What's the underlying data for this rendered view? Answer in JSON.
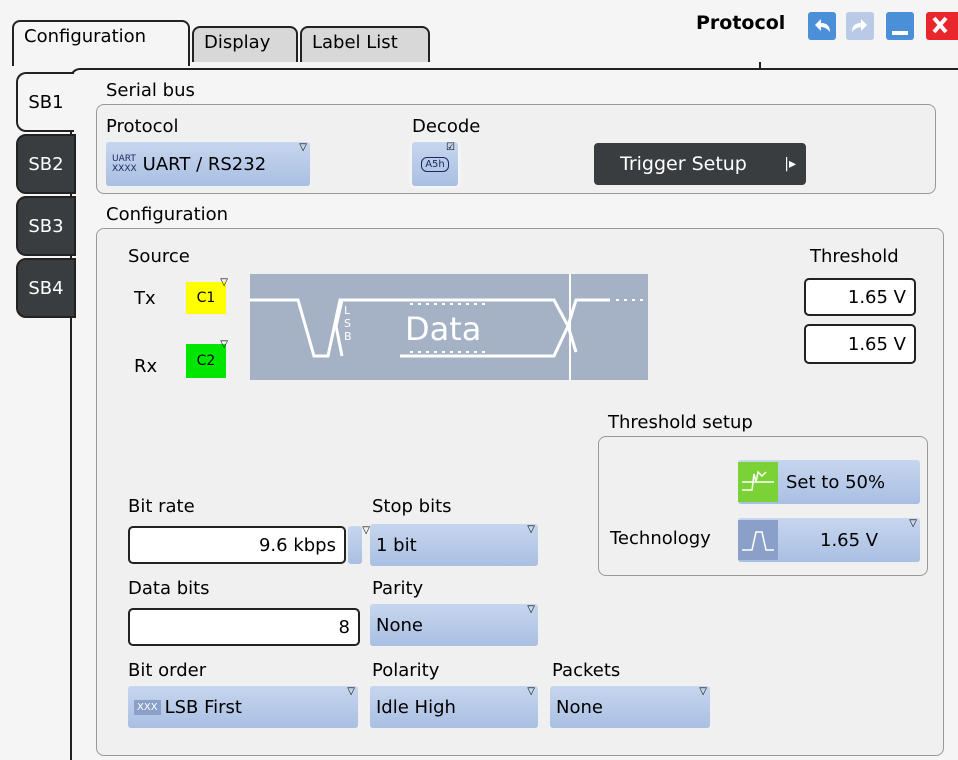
{
  "tabs": [
    "Configuration",
    "Display",
    "Label List"
  ],
  "title": "Protocol",
  "sb_tabs": [
    "SB1",
    "SB2",
    "SB3",
    "SB4"
  ],
  "serial_bus": {
    "heading": "Serial bus",
    "protocol_label": "Protocol",
    "protocol_value": "UART / RS232",
    "protocol_icon_text_top": "UART",
    "protocol_icon_text_bottom": "XXXX",
    "decode_label": "Decode",
    "decode_icon_text": "A5h",
    "trigger_setup": "Trigger Setup"
  },
  "configuration": {
    "heading": "Configuration",
    "source_label": "Source",
    "tx_label": "Tx",
    "rx_label": "Rx",
    "tx_source": "C1",
    "rx_source": "C2",
    "threshold_label": "Threshold",
    "threshold_tx": "1.65 V",
    "threshold_rx": "1.65 V",
    "diagram_lsb": "LSB",
    "diagram_data": "Data",
    "threshold_setup_label": "Threshold setup",
    "set_to_50": "Set to 50%",
    "technology_label": "Technology",
    "technology_value": "1.65 V",
    "bit_rate_label": "Bit rate",
    "bit_rate_value": "9.6 kbps",
    "stop_bits_label": "Stop bits",
    "stop_bits_value": "1 bit",
    "data_bits_label": "Data bits",
    "data_bits_value": "8",
    "parity_label": "Parity",
    "parity_value": "None",
    "bit_order_label": "Bit order",
    "bit_order_value": "LSB First",
    "polarity_label": "Polarity",
    "polarity_value": "Idle High",
    "packets_label": "Packets",
    "packets_value": "None"
  },
  "colors": {
    "c1": "#ffff00",
    "c2": "#00e600",
    "close": "#e8262c",
    "minimize": "#4a8fd8"
  }
}
